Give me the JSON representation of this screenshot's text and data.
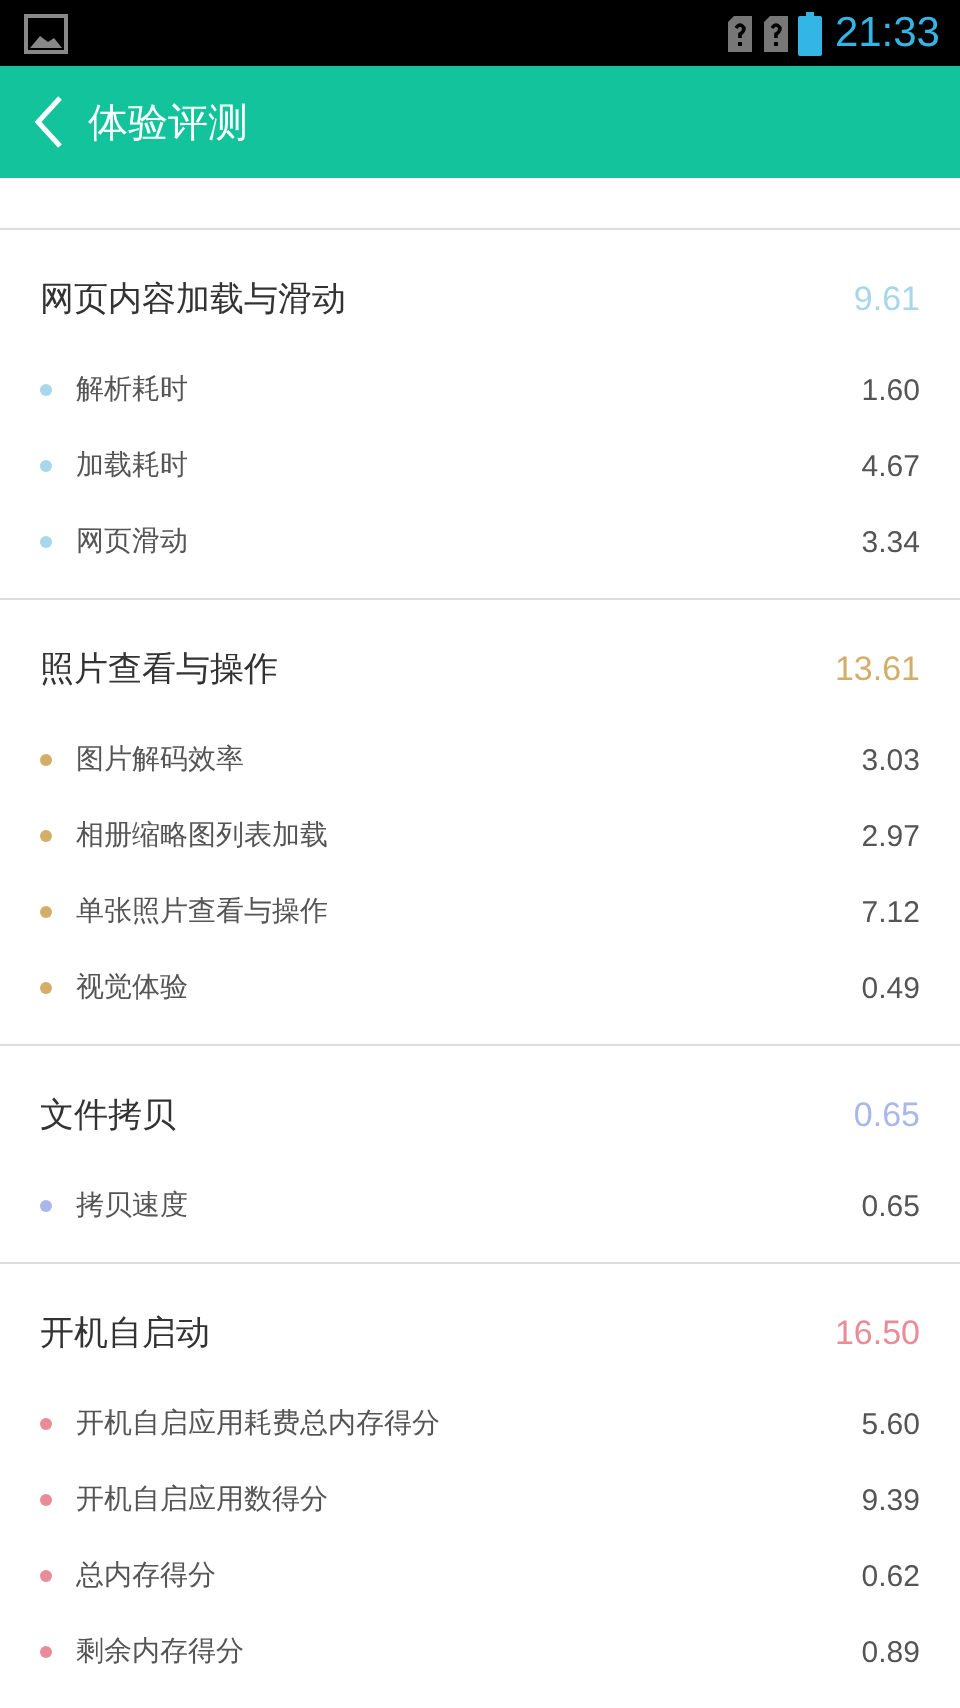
{
  "status_bar": {
    "time": "21:33"
  },
  "header": {
    "title": "体验评测"
  },
  "sections": [
    {
      "title": "网页内容加载与滑动",
      "score": "9.61",
      "color": "#a8d6ea",
      "items": [
        {
          "label": "解析耗时",
          "value": "1.60"
        },
        {
          "label": "加载耗时",
          "value": "4.67"
        },
        {
          "label": "网页滑动",
          "value": "3.34"
        }
      ]
    },
    {
      "title": "照片查看与操作",
      "score": "13.61",
      "color": "#d4ad68",
      "items": [
        {
          "label": "图片解码效率",
          "value": "3.03"
        },
        {
          "label": "相册缩略图列表加载",
          "value": "2.97"
        },
        {
          "label": "单张照片查看与操作",
          "value": "7.12"
        },
        {
          "label": "视觉体验",
          "value": "0.49"
        }
      ]
    },
    {
      "title": "文件拷贝",
      "score": "0.65",
      "color": "#a9b8ea",
      "items": [
        {
          "label": "拷贝速度",
          "value": "0.65"
        }
      ]
    },
    {
      "title": "开机自启动",
      "score": "16.50",
      "color": "#e88c98",
      "items": [
        {
          "label": "开机自启应用耗费总内存得分",
          "value": "5.60"
        },
        {
          "label": "开机自启应用数得分",
          "value": "9.39"
        },
        {
          "label": "总内存得分",
          "value": "0.62"
        },
        {
          "label": "剩余内存得分",
          "value": "0.89"
        }
      ]
    }
  ]
}
